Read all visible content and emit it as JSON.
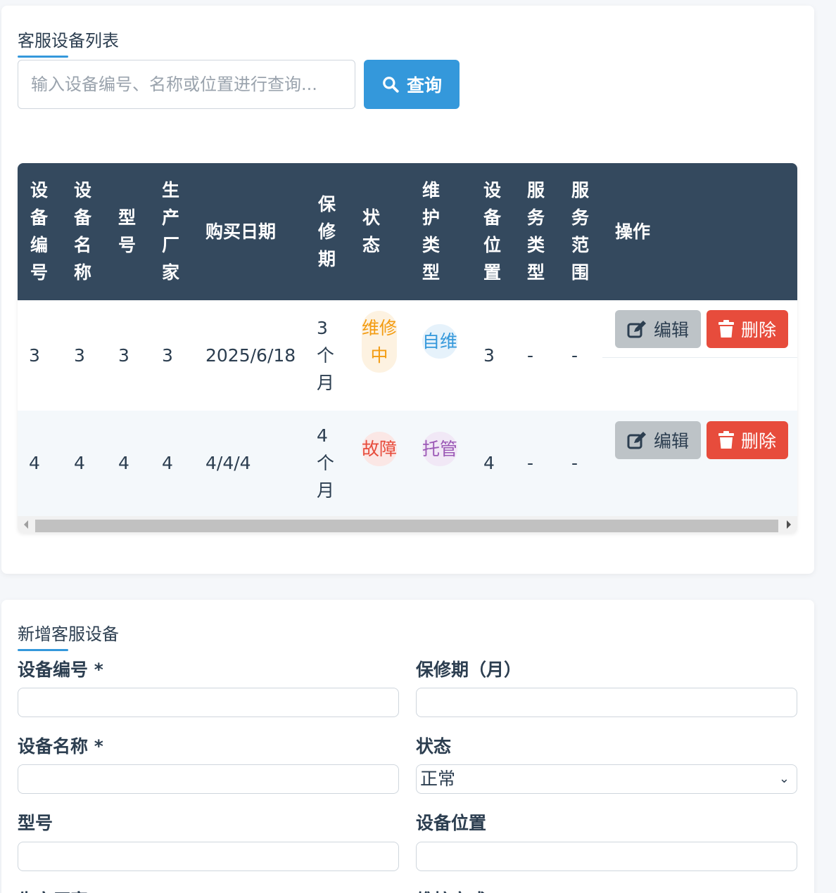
{
  "list_section": {
    "title": "客服设备列表",
    "search_placeholder": "输入设备编号、名称或位置进行查询...",
    "search_button": "查询"
  },
  "table": {
    "headers": [
      "设备编号",
      "设备名称",
      "型号",
      "生产厂家",
      "购买日期",
      "保修期",
      "状态",
      "维护类型",
      "设备位置",
      "服务类型",
      "服务范围",
      "操作"
    ],
    "rows": [
      {
        "id": "3",
        "name": "3",
        "model": "3",
        "manufacturer": "3",
        "purchase_date": "2025/6/18",
        "warranty": "3个月",
        "status": "维修中",
        "maintenance_type": "自维",
        "location": "3",
        "service_type": "-",
        "service_scope": "-"
      },
      {
        "id": "4",
        "name": "4",
        "model": "4",
        "manufacturer": "4",
        "purchase_date": "4/4/4",
        "warranty": "4个月",
        "status": "故障",
        "maintenance_type": "托管",
        "location": "4",
        "service_type": "-",
        "service_scope": "-"
      }
    ],
    "edit_label": "编辑",
    "delete_label": "删除"
  },
  "form_section": {
    "title": "新增客服设备",
    "labels": {
      "device_id": "设备编号 *",
      "warranty": "保修期（月）",
      "device_name": "设备名称 *",
      "status": "状态",
      "model": "型号",
      "location": "设备位置",
      "manufacturer": "生产厂家",
      "maintenance_method": "维护方式"
    },
    "status_value": "正常"
  },
  "colors": {
    "accent": "#3498db",
    "header_bg": "#34495e",
    "danger": "#e74c3c",
    "warning": "#f39c12",
    "purple": "#9b59b6"
  }
}
